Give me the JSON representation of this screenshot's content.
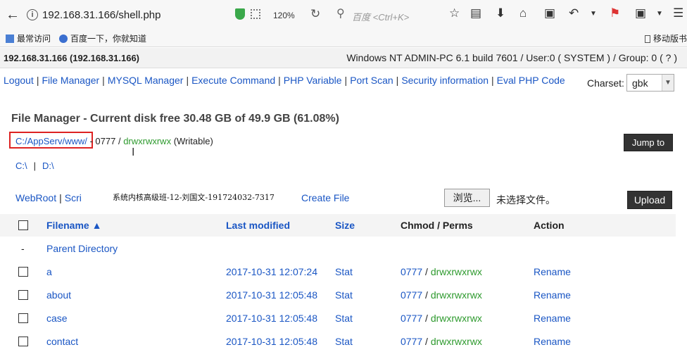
{
  "browser": {
    "url": "192.168.31.166/shell.php",
    "zoom": "120%",
    "search_placeholder": "百度 <Ctrl+K>",
    "bookmarks": [
      "最常访问",
      "百度一下，你就知道"
    ],
    "mobile_label": "移动版书"
  },
  "header": {
    "host": "192.168.31.166 (192.168.31.166)",
    "sysinfo": "Windows NT ADMIN-PC 6.1 build 7601 / User:0 ( SYSTEM ) / Group: 0 ( ? )"
  },
  "nav": {
    "items": [
      "Logout",
      "File Manager",
      "MYSQL Manager",
      "Execute Command",
      "PHP Variable",
      "Port Scan",
      "Security information",
      "Eval PHP Code"
    ],
    "charset_label": "Charset:",
    "charset_value": "gbk"
  },
  "fm": {
    "title": "File Manager - Current disk free 30.48 GB of 49.9 GB (61.08%)",
    "path": "C:/AppServ/www/",
    "path_sep": " - 0777 / ",
    "path_perm": "drwxrwxrwx",
    "path_state": " (Writable)",
    "jump_label": "Jump to",
    "drives": [
      "C:\\",
      "D:\\"
    ],
    "webroot": "WebRoot",
    "scri": "Scri",
    "overlay_text": "系统内核高级班-12-刘国文-191724032-7317",
    "create_file": "Create File",
    "browse": "浏览...",
    "no_file": "未选择文件。",
    "upload": "Upload"
  },
  "table": {
    "headers": {
      "filename": "Filename ▲",
      "modified": "Last modified",
      "size": "Size",
      "chmod": "Chmod / Perms",
      "action": "Action"
    },
    "parent": {
      "dash": "-",
      "label": "Parent Directory"
    },
    "rows": [
      {
        "name": "a",
        "date": "2017-10-31 12:07:24",
        "size": "Stat",
        "mode": "0777",
        "perm": "drwxrwxrwx",
        "action": "Rename"
      },
      {
        "name": "about",
        "date": "2017-10-31 12:05:48",
        "size": "Stat",
        "mode": "0777",
        "perm": "drwxrwxrwx",
        "action": "Rename"
      },
      {
        "name": "case",
        "date": "2017-10-31 12:05:48",
        "size": "Stat",
        "mode": "0777",
        "perm": "drwxrwxrwx",
        "action": "Rename"
      },
      {
        "name": "contact",
        "date": "2017-10-31 12:05:48",
        "size": "Stat",
        "mode": "0777",
        "perm": "drwxrwxrwx",
        "action": "Rename"
      }
    ]
  }
}
